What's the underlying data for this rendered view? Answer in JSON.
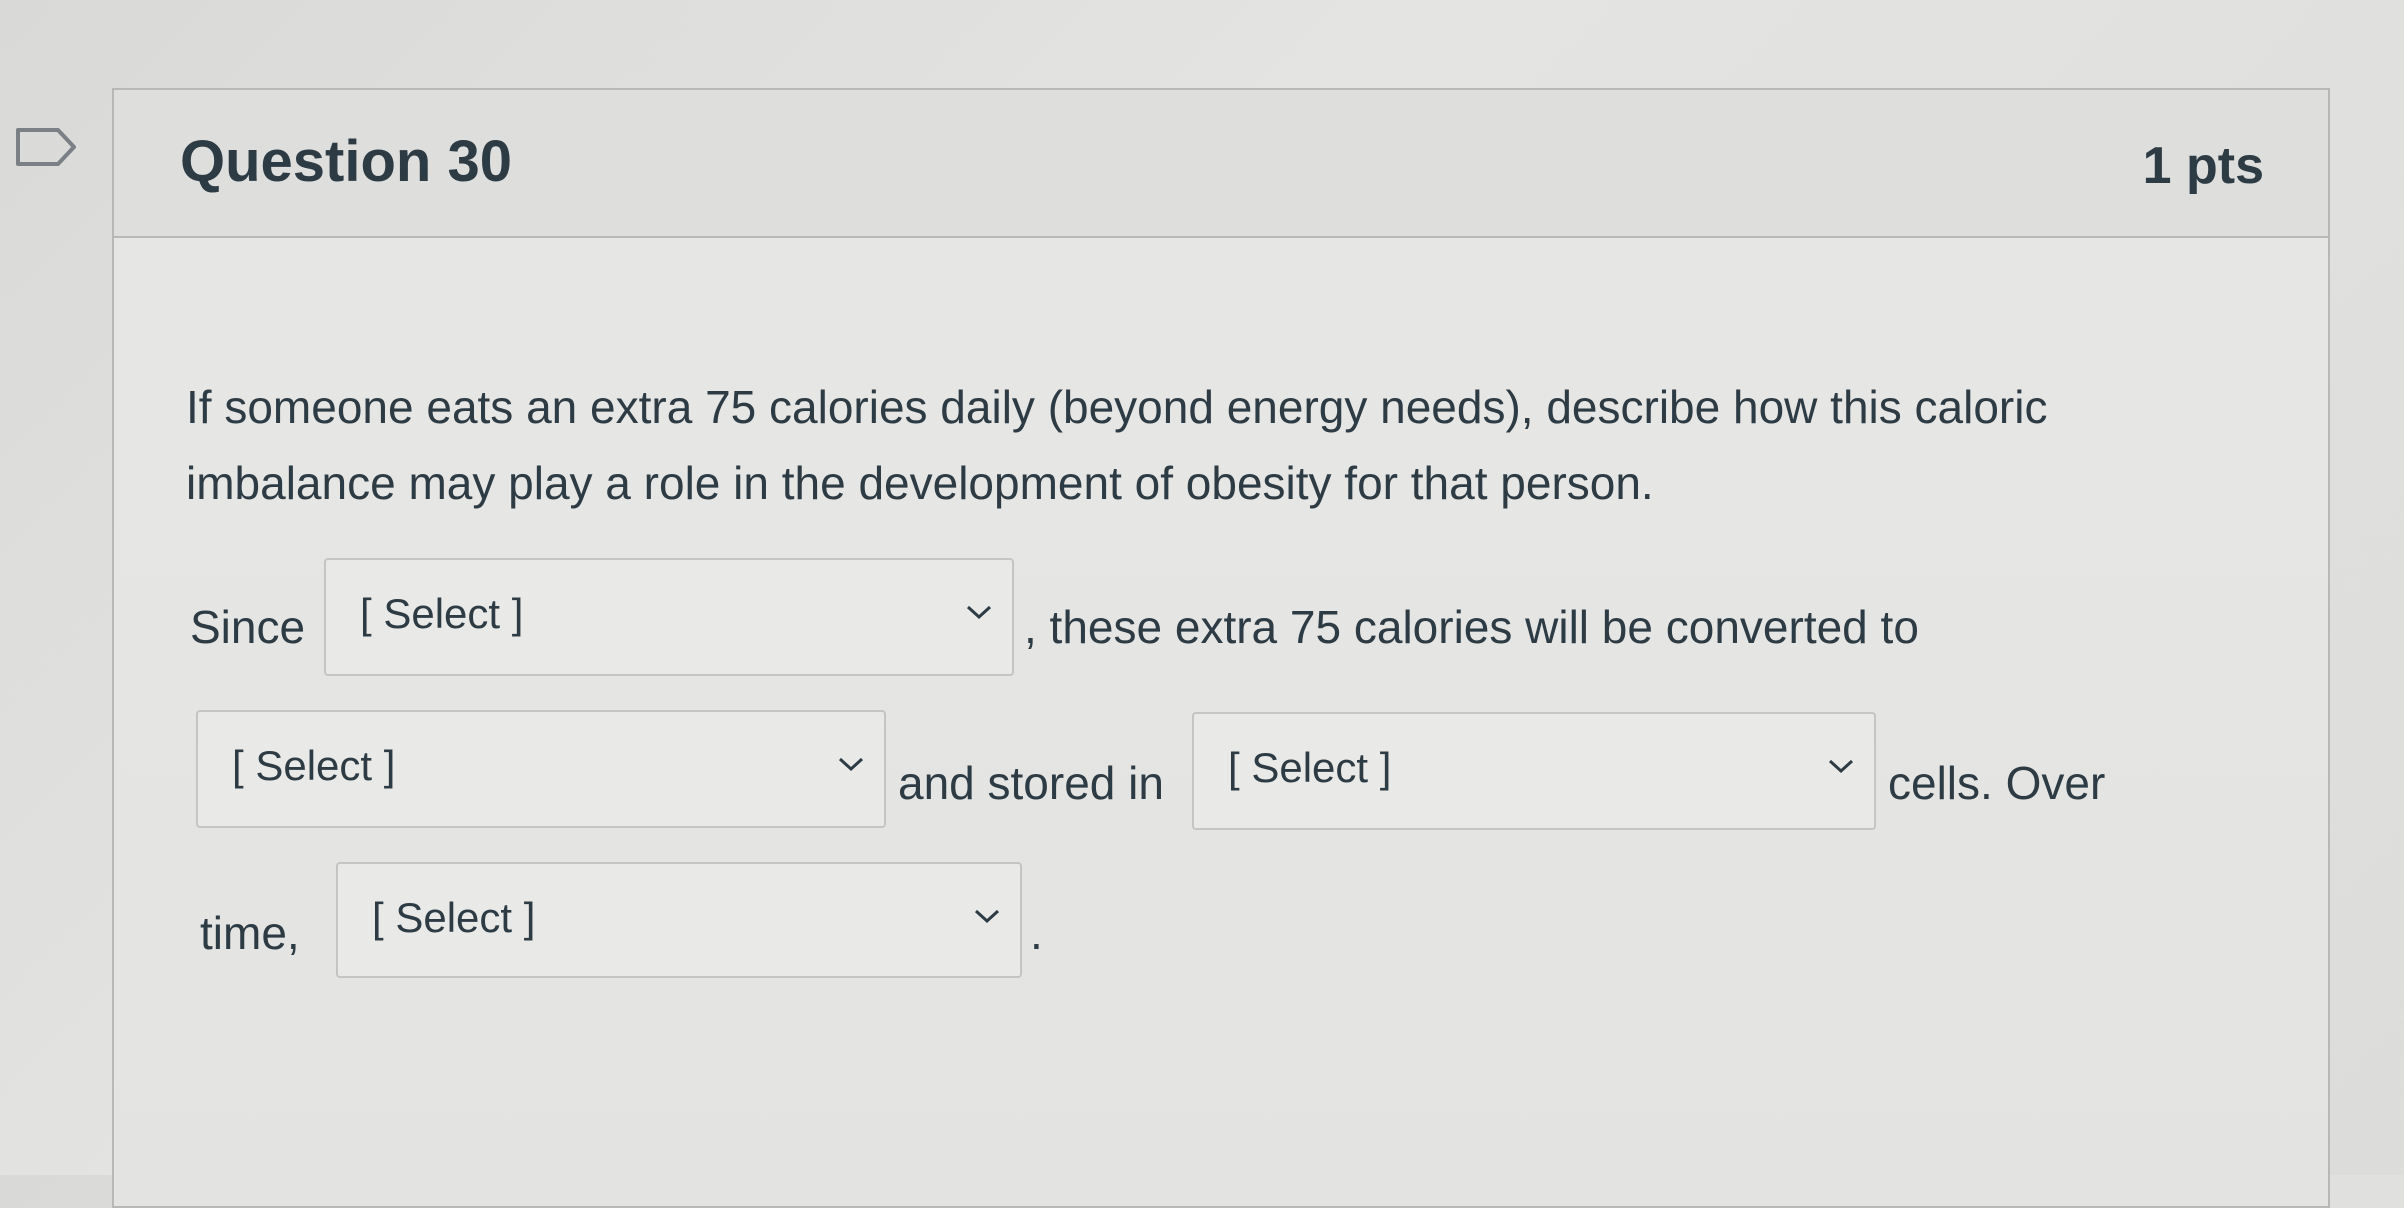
{
  "question": {
    "title": "Question 30",
    "points": "1 pts",
    "prompt_line1": "If someone eats an extra 75 calories daily (beyond energy needs), describe how this caloric",
    "prompt_line2": "imbalance may play a role in the development of obesity for that person."
  },
  "fill_in": {
    "since": "Since",
    "after_select1": ", these extra 75 calories will be converted to",
    "and_stored_in": "and stored in",
    "cells_over": "cells. Over",
    "time": "time,",
    "period": "."
  },
  "selects": [
    {
      "value": "[ Select ]"
    },
    {
      "value": "[ Select ]"
    },
    {
      "value": "[ Select ]"
    },
    {
      "value": "[ Select ]"
    }
  ],
  "icons": {
    "flag": "flag-icon",
    "dropdown": "chevron-down-icon"
  },
  "colors": {
    "text": "#2d3b45",
    "border": "#b8b9b7",
    "header_bg": "#dededc"
  }
}
